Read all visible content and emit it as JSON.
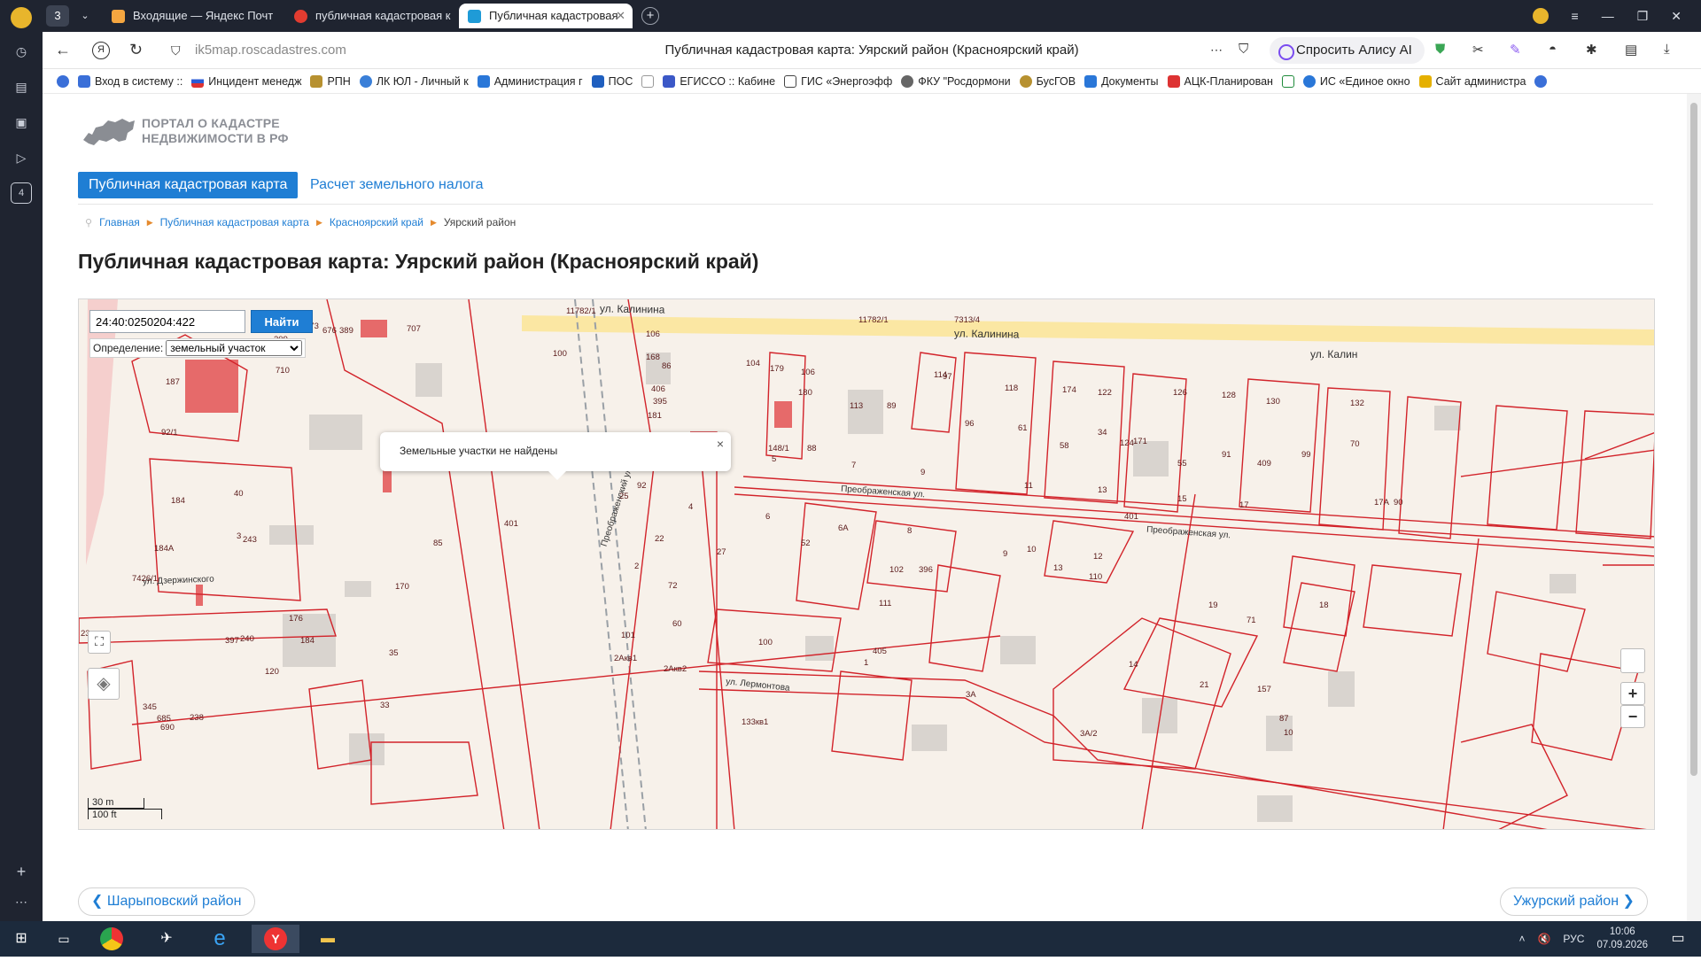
{
  "browser": {
    "tabs_count": "3",
    "tabs": [
      {
        "label": "Входящие — Яндекс Почт",
        "color": "#f4a640"
      },
      {
        "label": "публичная кадастровая к",
        "color": "#e23c30"
      },
      {
        "label": "Публичная кадастровая",
        "color": "#1f9bd7"
      }
    ],
    "url_host": "ik5map.roscadastres.com",
    "url_title": "Публичная кадастровая карта: Уярский район (Красноярский край)",
    "alice_label": "Спросить Алису AI",
    "bookmarks": [
      {
        "label": "Вход в систему ::",
        "color": "#3a6fd8"
      },
      {
        "label": "Инцидент менедж",
        "color": "#d33"
      },
      {
        "label": "РПН",
        "color": "#b79130"
      },
      {
        "label": "ЛК ЮЛ - Личный к",
        "color": "#3a7fd8"
      },
      {
        "label": "Администрация г",
        "color": "#2a77d8"
      },
      {
        "label": "ПОС",
        "color": "#1f5fbf"
      },
      {
        "label": "ЕГИССО :: Кабине",
        "color": "#3b58c7"
      },
      {
        "label": "ГИС «Энергоэфф",
        "color": "#444"
      },
      {
        "label": "ФКУ \"Росдормони",
        "color": "#666"
      },
      {
        "label": "БусГОВ",
        "color": "#b79130"
      },
      {
        "label": "Документы",
        "color": "#2a77d8"
      },
      {
        "label": "АЦК-Планирован",
        "color": "#d33"
      },
      {
        "label": "ИС «Единое окно",
        "color": "#2a77d8"
      },
      {
        "label": "Сайт администра",
        "color": "#e5b000"
      }
    ]
  },
  "portal": {
    "logo_line1": "ПОРТАЛ О КАДАСТРЕ",
    "logo_line2": "НЕДВИЖИМОСТИ В РФ",
    "tab_map": "Публичная кадастровая карта",
    "tab_tax": "Расчет земельного налога"
  },
  "breadcrumb": [
    "Главная",
    "Публичная кадастровая карта",
    "Красноярский край",
    "Уярский район"
  ],
  "page_title": "Публичная кадастровая карта: Уярский район (Красноярский край)",
  "map": {
    "search_value": "24:40:0250204:422",
    "find_label": "Найти",
    "definition_label": "Определение:",
    "definition_value": "земельный участок",
    "popup_text": "Земельные участки не найдены",
    "popup_close": "×",
    "zoom_in": "+",
    "zoom_out": "−",
    "scale_m": "30 m",
    "scale_ft": "100 ft",
    "streets": [
      "ул. Калинина",
      "ул. Калинина",
      "ул. Калин",
      "Преображенская ул.",
      "Преображенская ул.",
      "ул. Дзержинского",
      "ул. Лермонтова",
      "Преображенский ул."
    ],
    "parcel_labels": [
      "106",
      "168",
      "86",
      "406",
      "395",
      "181",
      "100",
      "104",
      "179",
      "106",
      "180",
      "113",
      "89",
      "114",
      "97",
      "118",
      "174",
      "122",
      "126",
      "128",
      "130",
      "132",
      "96",
      "61",
      "58",
      "34",
      "124",
      "171",
      "55",
      "91",
      "409",
      "99",
      "70",
      "148/1",
      "88",
      "3",
      "5",
      "7",
      "9",
      "11",
      "13",
      "15",
      "17",
      "17А",
      "90",
      "401",
      "4",
      "6",
      "6А",
      "8",
      "52",
      "25",
      "92",
      "22",
      "27",
      "72",
      "2",
      "60",
      "100",
      "101",
      "2Акв1",
      "2Акв2",
      "10",
      "9",
      "12",
      "110",
      "13",
      "19",
      "71",
      "18",
      "102",
      "396",
      "111",
      "405",
      "1",
      "14",
      "21",
      "157",
      "87",
      "10",
      "3А",
      "3А/2",
      "133кв1",
      "401",
      "85",
      "170",
      "35",
      "33",
      "120",
      "176",
      "184",
      "397",
      "240",
      "238",
      "685",
      "345",
      "690",
      "184",
      "40",
      "3",
      "243",
      "184А",
      "92/1",
      "187",
      "710",
      "209",
      "363",
      "673",
      "676",
      "389",
      "707",
      "11782/1",
      "11782/1",
      "7313/4",
      "7426/1",
      "23"
    ]
  },
  "pager": {
    "prev": "Шарыповский район",
    "next": "Ужурский район"
  },
  "taskbar": {
    "lang": "РУС",
    "time": "10:06",
    "date": "07.09.2026"
  }
}
